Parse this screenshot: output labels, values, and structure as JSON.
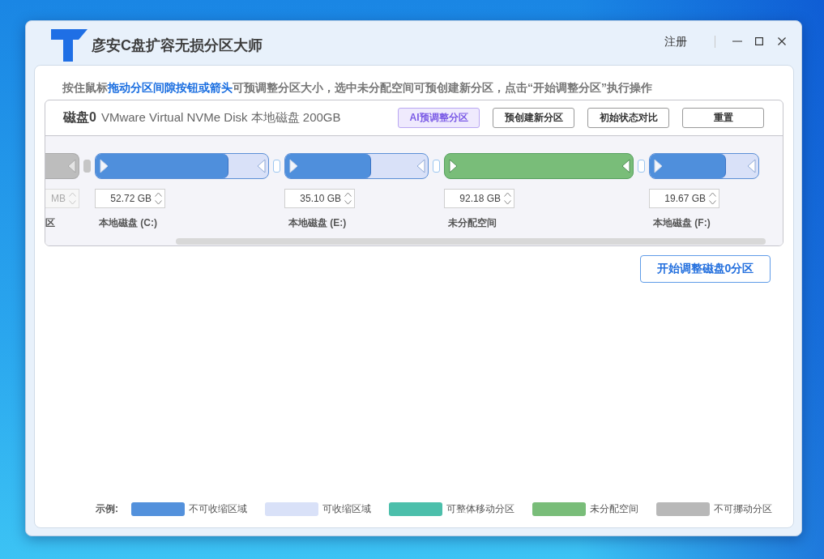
{
  "window": {
    "title": "彦安C盘扩容无损分区大师",
    "register": "注册"
  },
  "instruction": "按住鼠标**拖动分区间隙按钮或箭头**可预调整分区大小，选中未分配空间可预创建新分区，点击“开始调整分区”执行操作",
  "disk": {
    "name": "磁盘0",
    "description": "VMware Virtual NVMe Disk 本地磁盘 200GB",
    "buttons": [
      {
        "label": "AI预调整分区",
        "kind": "ai"
      },
      {
        "label": "预创建新分区",
        "kind": "plain"
      },
      {
        "label": "初始状态对比",
        "kind": "plain"
      },
      {
        "label": "重置",
        "kind": "plain"
      }
    ],
    "partitions": [
      {
        "kind": "locked",
        "size": "MB",
        "label": "区",
        "disabled": true
      },
      {
        "kind": "partition",
        "level": 0.77,
        "size": "52.72 GB",
        "label": "本地磁盘 (C:)",
        "disabled": false
      },
      {
        "kind": "partition",
        "level": 0.6,
        "size": "35.10 GB",
        "label": "本地磁盘 (E:)",
        "disabled": false
      },
      {
        "kind": "unallocated",
        "size": "92.18 GB",
        "label": "未分配空间",
        "disabled": false
      },
      {
        "kind": "partition",
        "level": 0.7,
        "size": "19.67 GB",
        "label": "本地磁盘 (F:)",
        "disabled": false
      }
    ]
  },
  "start_button": "开始调整磁盘0分区",
  "legend": {
    "title": "示例:",
    "items": [
      {
        "label": "不可收缩区域",
        "color": "#5391dc"
      },
      {
        "label": "可收缩区域",
        "color": "#d9e1f8"
      },
      {
        "label": "可整体移动分区",
        "color": "#4cbfab"
      },
      {
        "label": "未分配空间",
        "color": "#79bd79"
      },
      {
        "label": "不可挪动分区",
        "color": "#b8b8b8"
      }
    ]
  }
}
